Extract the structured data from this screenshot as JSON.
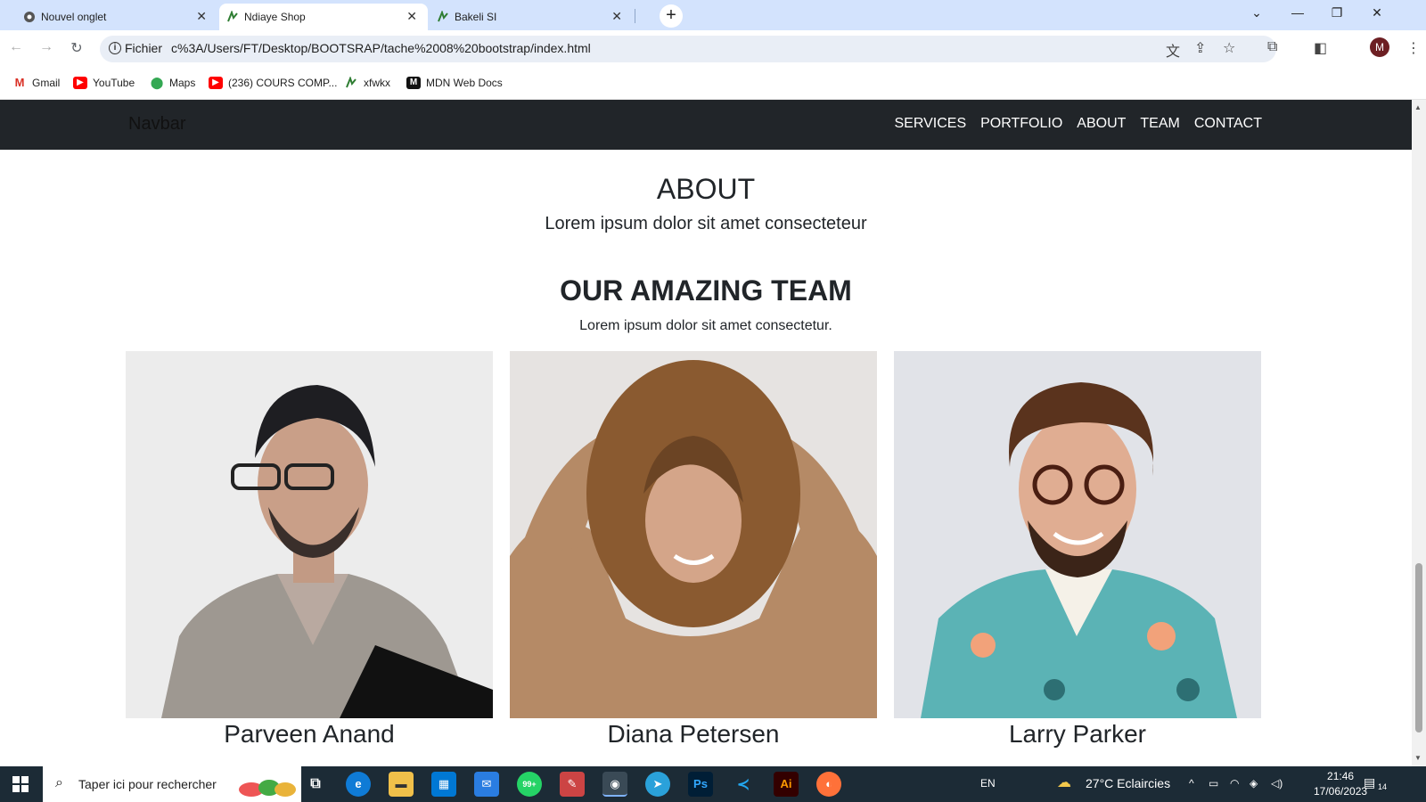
{
  "browser": {
    "tabs": [
      {
        "title": "Nouvel onglet"
      },
      {
        "title": "Ndiaye Shop"
      },
      {
        "title": "Bakeli SI"
      }
    ],
    "address_chip": "Fichier",
    "address_url": "c%3A/Users/FT/Desktop/BOOTSRAP/tache%2008%20bootstrap/index.html",
    "avatar_letter": "M",
    "bookmarks": [
      {
        "label": "Gmail"
      },
      {
        "label": "YouTube"
      },
      {
        "label": "Maps"
      },
      {
        "label": "(236) COURS COMP..."
      },
      {
        "label": "xfwkx"
      },
      {
        "label": "MDN Web Docs"
      }
    ]
  },
  "site": {
    "brand": "Navbar",
    "nav": [
      "SERVICES",
      "PORTFOLIO",
      "ABOUT",
      "TEAM",
      "CONTACT"
    ],
    "about_title": "ABOUT",
    "about_subtitle": "Lorem ipsum dolor sit amet consecteteur",
    "team_title": "OUR AMAZING TEAM",
    "team_subtitle": "Lorem ipsum dolor sit amet consectetur.",
    "team": [
      {
        "name": "Parveen Anand"
      },
      {
        "name": "Diana Petersen"
      },
      {
        "name": "Larry Parker"
      }
    ]
  },
  "taskbar": {
    "search_placeholder": "Taper ici pour rechercher",
    "whatsapp_badge": "99+",
    "lang": "EN",
    "weather": "27°C  Eclaircies",
    "time": "21:46",
    "date": "17/06/2023",
    "notif_count": "14"
  },
  "colors": {
    "tabstrip": "#d3e3fd",
    "navbar": "#212529",
    "taskbar": "#1c2b36"
  }
}
